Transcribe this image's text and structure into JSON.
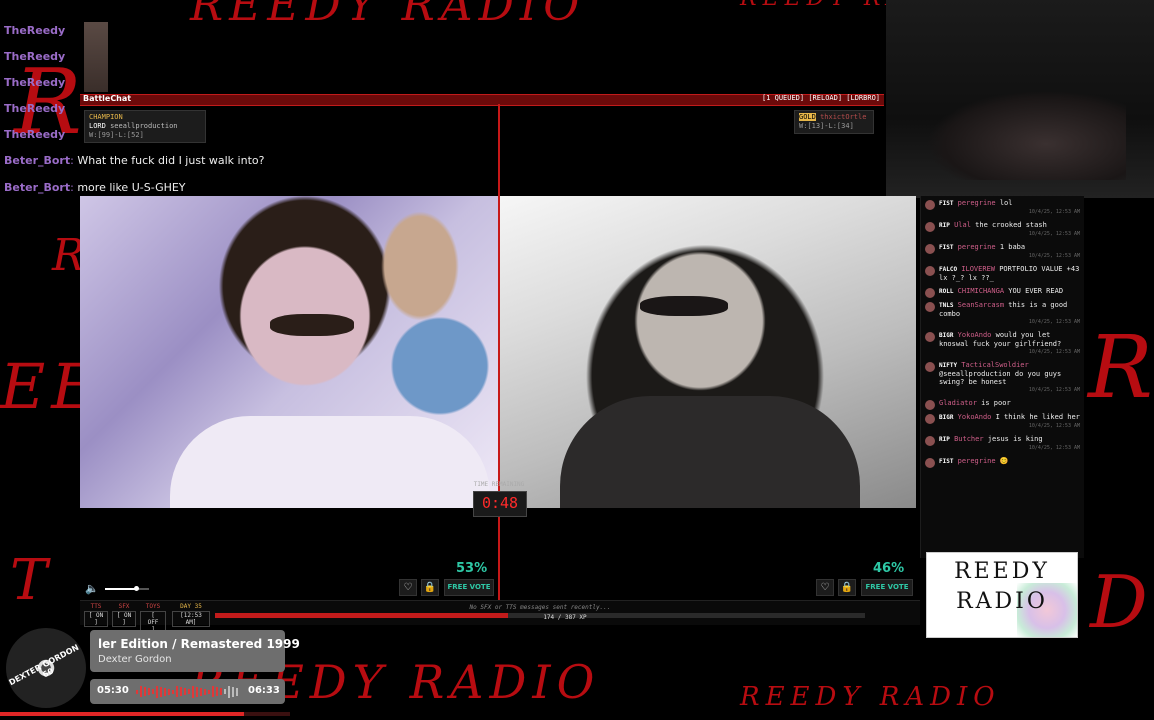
{
  "stream": {
    "top_scrawl": "REEDY RADIO",
    "bottom_scrawl": "REEDY RADIO",
    "side_letters": [
      "R",
      "EE",
      "R",
      "R",
      "D",
      "T"
    ]
  },
  "overlay_chat": {
    "users": [
      "TheReedy",
      "TheReedy",
      "TheReedy",
      "TheReedy",
      "TheReedy"
    ],
    "messages": [
      {
        "user": "Beter_Bort",
        "text": "What the fuck did I just walk into?"
      },
      {
        "user": "Beter_Bort",
        "text": "more like U-S-GHEY"
      }
    ]
  },
  "battle": {
    "title": "BattleChat",
    "queued": "[1 QUEUED]",
    "reload": "[RELOAD]",
    "lordbro": "[LDRBRO]",
    "left_player": {
      "rank": "CHAMPION",
      "name": "seeallproduction",
      "role": "LORD",
      "record": "W:[99]-L:[52]"
    },
    "right_player": {
      "rank": "GOLD",
      "name": "thxictOrtle",
      "record": "W:[13]-L:[34]"
    },
    "time_label": "TIME REMAINING",
    "timer": "0:48",
    "left_pct": "53%",
    "right_pct": "46%",
    "free_vote": "FREE VOTE",
    "volume": 0.7
  },
  "stats": {
    "tts": {
      "label": "TTS",
      "value": "[ ON ]"
    },
    "sfx": {
      "label": "SFX",
      "value": "[ ON ]"
    },
    "toys": {
      "label": "TOYS",
      "value": "[ OFF ]"
    },
    "day": {
      "label": "DAY 35",
      "value": "[12:53 AM]"
    },
    "status": "No SFX or TTS messages sent recently...",
    "xp": "174 / 387 XP",
    "xp_fraction": 0.45
  },
  "chat": [
    {
      "badge": "FIST",
      "user": "peregrine",
      "text": "lol",
      "ts": "10/4/25, 12:53 AM"
    },
    {
      "badge": "RIP",
      "user": "Ulal",
      "text": "the crooked stash",
      "ts": "10/4/25, 12:53 AM"
    },
    {
      "badge": "FIST",
      "user": "peregrine",
      "text": "1 baba",
      "ts": "10/4/25, 12:53 AM"
    },
    {
      "badge": "FALCO",
      "user": "ILOVEREW",
      "text": "PORTFOLIO VALUE +43  lx ?_? lx ??_",
      "ts": ""
    },
    {
      "badge": "ROLL",
      "user": "CHIMICHANGA",
      "text": "YOU EVER READ",
      "ts": ""
    },
    {
      "badge": "TNLS",
      "user": "SeanSarcasm",
      "text": "this is a good combo",
      "ts": "10/4/25, 12:53 AM"
    },
    {
      "badge": "BIGR",
      "user": "YokoAndo",
      "text": "would you let knoswal fuck your girlfriend?",
      "ts": "10/4/25, 12:53 AM"
    },
    {
      "badge": "NIFTY",
      "user": "TacticalSwoldier",
      "text": "@seeallproduction do you guys swing? be honest",
      "ts": "10/4/25, 12:53 AM"
    },
    {
      "badge": "",
      "user": "Gladiator",
      "text": "is poor",
      "ts": ""
    },
    {
      "badge": "BIGR",
      "user": "YokoAndo",
      "text": "I think he liked her",
      "ts": "10/4/25, 12:53 AM"
    },
    {
      "badge": "RIP",
      "user": "Butcher",
      "text": "jesus is king",
      "ts": "10/4/25, 12:53 AM"
    },
    {
      "badge": "FIST",
      "user": "peregrine",
      "text": "😊",
      "ts": ""
    }
  ],
  "logo": {
    "line1": "REEDY",
    "line2": "RADIO"
  },
  "now_playing": {
    "title": "ler Edition / Remastered 1999",
    "artist": "Dexter Gordon",
    "elapsed": "05:30",
    "duration": "06:33",
    "disc_label": "DEXTER GORDON 60",
    "progress": 0.84
  },
  "colors": {
    "accent": "#c21b1b",
    "vote": "#2ec8a6",
    "timer": "#ff2a2a"
  }
}
